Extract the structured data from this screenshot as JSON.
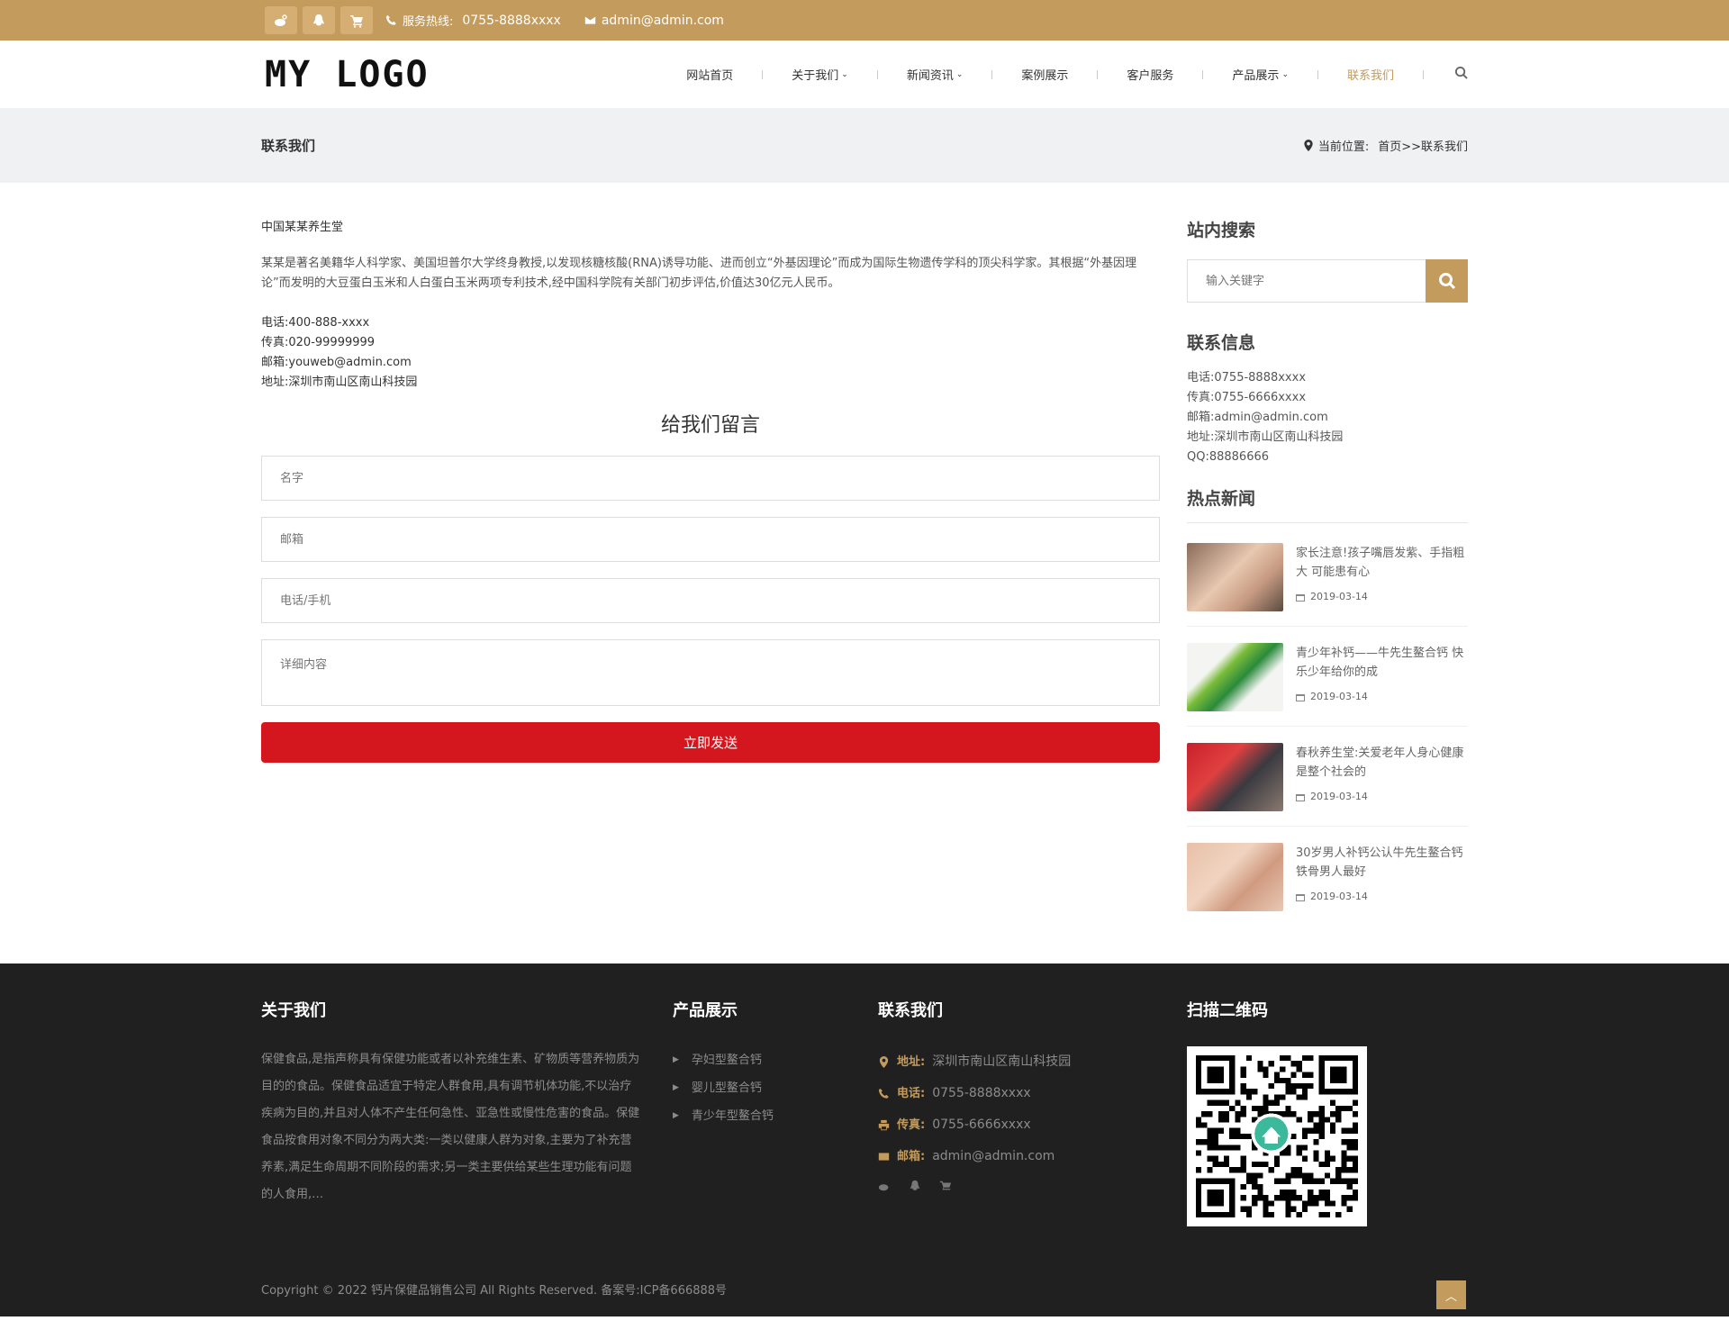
{
  "topbar": {
    "hotline_label": "服务热线:",
    "hotline": "0755-8888xxxx",
    "email": "admin@admin.com",
    "icons": [
      "weibo-icon",
      "qq-icon",
      "cart-icon"
    ]
  },
  "header": {
    "logo": "MY LOGO",
    "nav": [
      {
        "label": "网站首页",
        "dropdown": false,
        "active": false
      },
      {
        "label": "关于我们",
        "dropdown": true,
        "active": false
      },
      {
        "label": "新闻资讯",
        "dropdown": true,
        "active": false
      },
      {
        "label": "案例展示",
        "dropdown": false,
        "active": false
      },
      {
        "label": "客户服务",
        "dropdown": false,
        "active": false
      },
      {
        "label": "产品展示",
        "dropdown": true,
        "active": false
      },
      {
        "label": "联系我们",
        "dropdown": false,
        "active": true
      }
    ]
  },
  "titlebar": {
    "title": "联系我们",
    "crumb_label": "当前位置:",
    "crumb_path": "首页>>联系我们"
  },
  "content": {
    "company": "中国某某养生堂",
    "intro": "某某是著名美籍华人科学家、美国坦普尔大学终身教授,以发现核糖核酸(RNA)诱导功能、进而创立“外基因理论”而成为国际生物遗传学科的顶尖科学家。其根据“外基因理论”而发明的大豆蛋白玉米和人白蛋白玉米两项专利技术,经中国科学院有关部门初步评估,价值达30亿元人民币。",
    "contacts": [
      "电话:400-888-xxxx",
      "传真:020-99999999",
      "邮箱:youweb@admin.com",
      "地址:深圳市南山区南山科技园"
    ]
  },
  "form": {
    "title": "给我们留言",
    "name_placeholder": "名字",
    "email_placeholder": "邮箱",
    "phone_placeholder": "电话/手机",
    "detail_placeholder": "详细内容",
    "submit": "立即发送"
  },
  "sidebar": {
    "search_title": "站内搜索",
    "search_placeholder": "输入关键字",
    "info_title": "联系信息",
    "info": [
      "电话:0755-8888xxxx",
      "传真:0755-6666xxxx",
      "邮箱:admin@admin.com",
      "地址:深圳市南山区南山科技园",
      "QQ:88886666"
    ],
    "hot_title": "热点新闻",
    "news": [
      {
        "title": "家长注意!孩子嘴唇发紫、手指粗大 可能患有心",
        "date": "2019-03-14"
      },
      {
        "title": "青少年补钙——牛先生鳌合钙 快乐少年给你的成",
        "date": "2019-03-14"
      },
      {
        "title": "春秋养生堂:关爱老年人身心健康是整个社会的",
        "date": "2019-03-14"
      },
      {
        "title": "30岁男人补钙公认牛先生鳌合钙铁骨男人最好",
        "date": "2019-03-14"
      }
    ]
  },
  "footer": {
    "about_title": "关于我们",
    "about_text": "保健食品,是指声称具有保健功能或者以补充维生素、矿物质等营养物质为目的的食品。保健食品适宜于特定人群食用,具有调节机体功能,不以治疗疾病为目的,并且对人体不产生任何急性、亚急性或慢性危害的食品。保健食品按食用对象不同分为两大类:一类以健康人群为对象,主要为了补充营养素,满足生命周期不同阶段的需求;另一类主要供给某些生理功能有问题的人食用,…",
    "prod_title": "产品展示",
    "products": [
      "孕妇型鳌合钙",
      "婴儿型鳌合钙",
      "青少年型鳌合钙"
    ],
    "contact_title": "联系我们",
    "addr_label": "地址:",
    "addr": "深圳市南山区南山科技园",
    "tel_label": "电话:",
    "tel": "0755-8888xxxx",
    "fax_label": "传真:",
    "fax": "0755-6666xxxx",
    "mail_label": "邮箱:",
    "mail": "admin@admin.com",
    "qr_title": "扫描二维码",
    "copyright": "Copyright © 2022 钙片保健品销售公司 All Rights Reserved. 备案号:ICP备666888号",
    "accent": "#c39b5c"
  }
}
